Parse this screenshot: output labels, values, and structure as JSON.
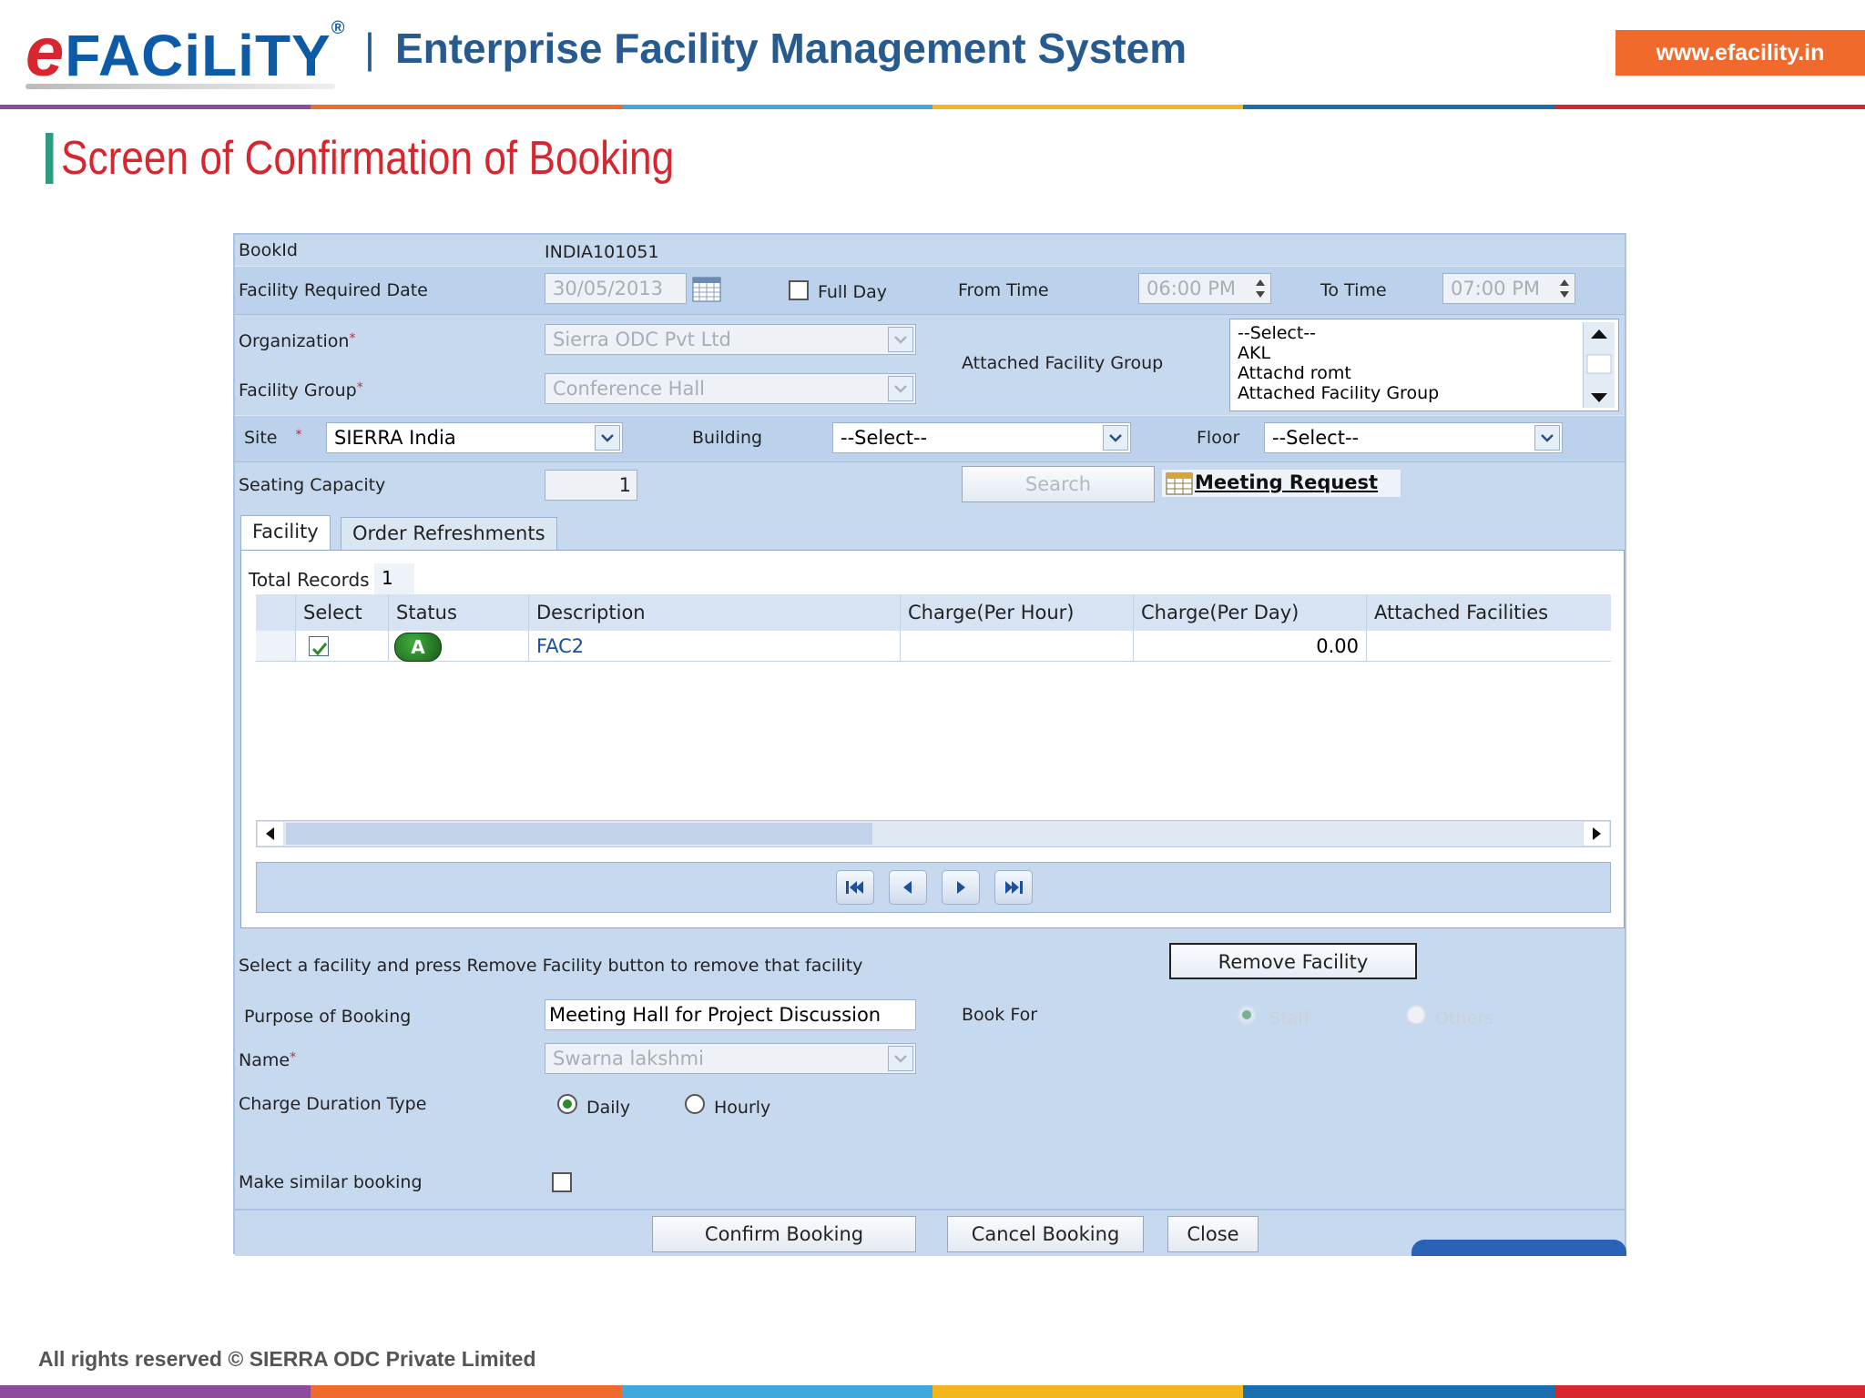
{
  "header": {
    "logo_e": "e",
    "logo_rest": "FACiLiTY",
    "logo_reg": "®",
    "separator": "|",
    "system_title": "Enterprise Facility Management System",
    "website": "www.efacility.in",
    "stripe_colors": [
      "#8e4a9c",
      "#ef6a2c",
      "#3fa9dd",
      "#f2b61f",
      "#1a6fb0",
      "#d7262d"
    ]
  },
  "page_title": "Screen  of Confirmation of Booking",
  "form": {
    "bookid_label": "BookId",
    "bookid_value": "INDIA101051",
    "date_label": "Facility Required Date",
    "date_value": "30/05/2013",
    "fullday_label": "Full Day",
    "from_time_label": "From Time",
    "from_time_value": "06:00 PM",
    "to_time_label": "To Time",
    "to_time_value": "07:00 PM",
    "organization_label": "Organization",
    "organization_value": "Sierra ODC Pvt Ltd",
    "facility_group_label": "Facility Group",
    "facility_group_value": "Conference Hall",
    "attached_group_label": "Attached Facility Group",
    "attached_group_options": [
      "--Select--",
      "AKL",
      "Attachd romt",
      "Attached Facility Group"
    ],
    "required_mark": "*",
    "site_label": "Site",
    "site_value": "SIERRA India",
    "building_label": "Building",
    "building_value": "--Select--",
    "floor_label": "Floor",
    "floor_value": "--Select--",
    "seating_label": "Seating Capacity",
    "seating_value": "1",
    "search_label": "Search",
    "meeting_request_label": "Meeting Request",
    "tabs": [
      {
        "label": "Facility",
        "active": true
      },
      {
        "label": "Order Refreshments",
        "active": false
      }
    ],
    "total_records_label": "Total Records :",
    "total_records_value": "1",
    "table": {
      "columns": [
        "Select",
        "Status",
        "Description",
        "Charge(Per Hour)",
        "Charge(Per Day)",
        "Attached Facilities"
      ],
      "rows": [
        {
          "selected": true,
          "status": "A",
          "description": "FAC2",
          "charge_hour": "",
          "charge_day": "0.00",
          "attached": ""
        }
      ]
    },
    "remove_hint": "Select a facility and press Remove Facility button to remove that facility",
    "remove_button": "Remove Facility",
    "purpose_label": "Purpose of Booking",
    "purpose_value": "Meeting Hall for Project Discussion",
    "book_for_label": "Book For",
    "book_for_staff": "Staff",
    "book_for_others": "Others",
    "name_label": "Name",
    "name_value": "Swarna lakshmi",
    "charge_type_label": "Charge Duration Type",
    "charge_daily": "Daily",
    "charge_hourly": "Hourly",
    "similar_label": "Make similar booking",
    "confirm_button": "Confirm Booking",
    "cancel_button": "Cancel Booking",
    "close_button": "Close"
  },
  "footer": "All rights reserved © SIERRA ODC Private Limited"
}
